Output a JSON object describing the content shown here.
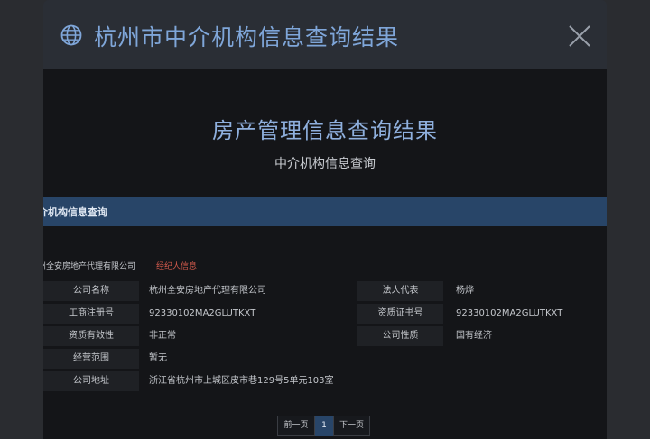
{
  "modal": {
    "title": "杭州市中介机构信息查询结果"
  },
  "body": {
    "main_title": "房产管理信息查询结果",
    "sub_title": "中介机构信息查询",
    "section_label": "介机构信息查询",
    "company_line": "州全安房地产代理有限公司",
    "agent_link": "经纪人信息"
  },
  "info": {
    "left": [
      {
        "label": "公司名称",
        "value": "杭州全安房地产代理有限公司"
      },
      {
        "label": "工商注册号",
        "value": "92330102MA2GLUTKXT"
      },
      {
        "label": "资质有效性",
        "value": "非正常"
      },
      {
        "label": "经营范围",
        "value": "暂无"
      },
      {
        "label": "公司地址",
        "value": "浙江省杭州市上城区皮市巷129号5单元103室"
      }
    ],
    "right": [
      {
        "label": "法人代表",
        "value": "杨烨"
      },
      {
        "label": "资质证书号",
        "value": "92330102MA2GLUTKXT"
      },
      {
        "label": "公司性质",
        "value": "国有经济"
      }
    ]
  },
  "pagination": {
    "prev": "前一页",
    "current": "1",
    "next": "下一页"
  },
  "colors": {
    "accent": "#284568",
    "title_blue": "#7fa6d9",
    "link_red": "#d25a4c"
  },
  "icons": {
    "header": "globe-icon",
    "close": "close-icon"
  }
}
